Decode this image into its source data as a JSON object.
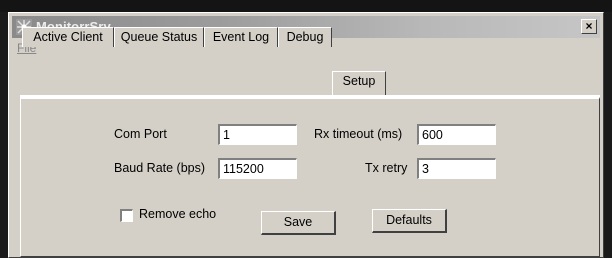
{
  "window": {
    "title": "MonitorrSrv",
    "close_glyph": "×"
  },
  "menu": {
    "file": "File"
  },
  "tabs": [
    {
      "label": "Active Client"
    },
    {
      "label": "Queue Status"
    },
    {
      "label": "Event Log"
    },
    {
      "label": "Debug"
    },
    {
      "label": "Setup",
      "active": true
    }
  ],
  "setup": {
    "com_port_label": "Com Port",
    "com_port_value": "1",
    "rx_timeout_label": "Rx timeout (ms)",
    "rx_timeout_value": "600",
    "baud_rate_label": "Baud Rate (bps)",
    "baud_rate_value": "115200",
    "tx_retry_label": "Tx retry",
    "tx_retry_value": "3",
    "remove_echo_label": "Remove echo",
    "remove_echo_checked": false,
    "save_label": "Save",
    "defaults_label": "Defaults"
  }
}
